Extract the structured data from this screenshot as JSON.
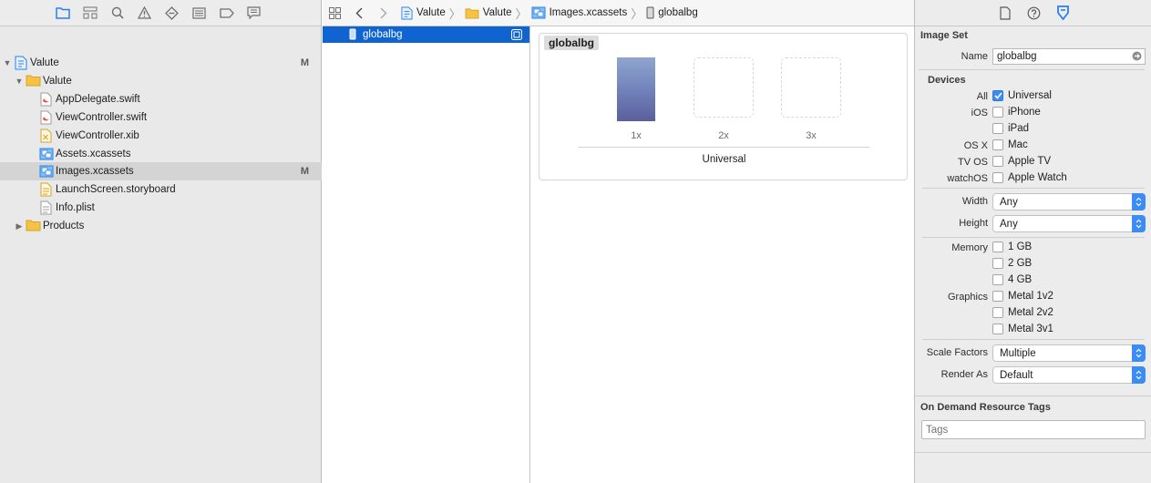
{
  "navigator": {
    "toolbar_icons": [
      "folder-icon",
      "hierarchy-icon",
      "search-icon",
      "warning-icon",
      "test-icon",
      "debug-icon",
      "breakpoint-icon",
      "report-icon"
    ],
    "tree": [
      {
        "label": "Valute",
        "icon": "project-icon",
        "disclosure": "expanded",
        "badge": "M"
      },
      {
        "label": "Valute",
        "icon": "folder-icon",
        "disclosure": "expanded",
        "badge": ""
      },
      {
        "label": "AppDelegate.swift",
        "icon": "swift-file-icon",
        "badge": ""
      },
      {
        "label": "ViewController.swift",
        "icon": "swift-file-icon",
        "badge": ""
      },
      {
        "label": "ViewController.xib",
        "icon": "xib-file-icon",
        "badge": ""
      },
      {
        "label": "Assets.xcassets",
        "icon": "asset-catalog-icon",
        "badge": ""
      },
      {
        "label": "Images.xcassets",
        "icon": "asset-catalog-icon",
        "badge": "M",
        "selected": true
      },
      {
        "label": "LaunchScreen.storyboard",
        "icon": "storyboard-file-icon",
        "badge": ""
      },
      {
        "label": "Info.plist",
        "icon": "plist-file-icon",
        "badge": ""
      },
      {
        "label": "Products",
        "icon": "folder-icon",
        "disclosure": "collapsed",
        "badge": ""
      }
    ]
  },
  "jumpbar": {
    "crumbs": [
      {
        "label": "Valute",
        "icon": "project-icon"
      },
      {
        "label": "Valute",
        "icon": "folder-icon"
      },
      {
        "label": "Images.xcassets",
        "icon": "asset-catalog-icon"
      },
      {
        "label": "globalbg",
        "icon": "image-set-icon"
      }
    ]
  },
  "asset_list": {
    "items": [
      {
        "label": "globalbg",
        "selected": true
      }
    ]
  },
  "asset_detail": {
    "set_name": "globalbg",
    "slots": [
      {
        "label": "1x",
        "filled": true
      },
      {
        "label": "2x",
        "filled": false
      },
      {
        "label": "3x",
        "filled": false
      }
    ],
    "group_label": "Universal"
  },
  "inspector": {
    "toolbar_icons": [
      "file-inspector-icon",
      "quick-help-icon",
      "attributes-inspector-icon"
    ],
    "image_set_title": "Image Set",
    "name_label": "Name",
    "name_value": "globalbg",
    "devices_title": "Devices",
    "device_rows": [
      {
        "label": "All",
        "option": "Universal",
        "checked": true
      },
      {
        "label": "iOS",
        "option": "iPhone",
        "checked": false
      },
      {
        "label": "",
        "option": "iPad",
        "checked": false
      },
      {
        "label": "OS X",
        "option": "Mac",
        "checked": false
      },
      {
        "label": "TV OS",
        "option": "Apple TV",
        "checked": false
      },
      {
        "label": "watchOS",
        "option": "Apple Watch",
        "checked": false
      }
    ],
    "width_label": "Width",
    "width_value": "Any",
    "height_label": "Height",
    "height_value": "Any",
    "memory_label": "Memory",
    "memory_options": [
      {
        "option": "1 GB",
        "checked": false
      },
      {
        "option": "2 GB",
        "checked": false
      },
      {
        "option": "4 GB",
        "checked": false
      }
    ],
    "graphics_label": "Graphics",
    "graphics_options": [
      {
        "option": "Metal 1v2",
        "checked": false
      },
      {
        "option": "Metal 2v2",
        "checked": false
      },
      {
        "option": "Metal 3v1",
        "checked": false
      }
    ],
    "scale_factors_label": "Scale Factors",
    "scale_factors_value": "Multiple",
    "render_as_label": "Render As",
    "render_as_value": "Default",
    "odr_title": "On Demand Resource Tags",
    "tags_placeholder": "Tags"
  },
  "colors": {
    "accent": "#3c8cf6",
    "selection": "#0f64d2",
    "folder": "#f5c242"
  }
}
